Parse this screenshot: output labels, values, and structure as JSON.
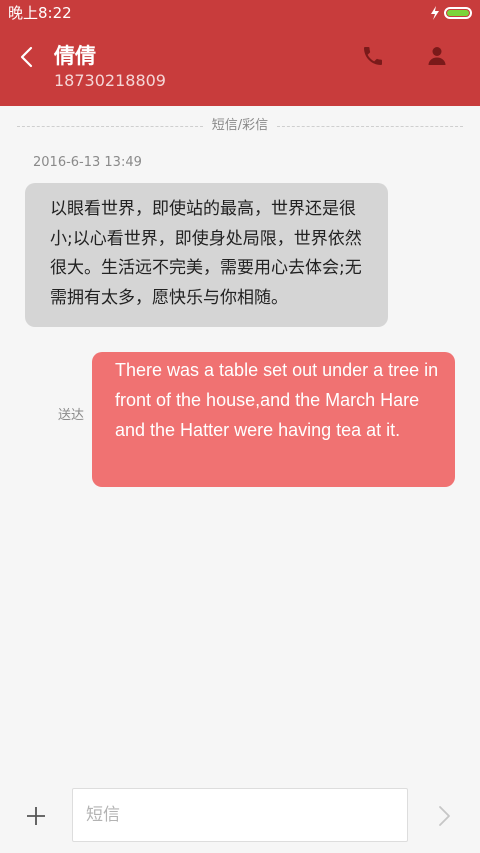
{
  "status_bar": {
    "time": "晚上8:22",
    "battery_level": 1.0,
    "battery_color": "#7bd43a"
  },
  "header": {
    "contact_name": "倩倩",
    "contact_number": "18730218809",
    "background_color": "#c83c3c",
    "back_icon": "chevron-left-icon",
    "call_icon": "phone-icon",
    "contact_icon": "person-icon"
  },
  "conversation": {
    "divider_label": "短信/彩信",
    "timestamp": "2016-6-13 13:49",
    "messages": [
      {
        "direction": "incoming",
        "text": "以眼看世界，即使站的最高，世界还是很小;以心看世界，即使身处局限，世界依然很大。生活远不完美，需要用心去体会;无需拥有太多，愿快乐与你相随。",
        "bubble_color": "#d5d5d5"
      },
      {
        "direction": "outgoing",
        "status": "送达",
        "text": "There was a table set out under a tree in front of the house,and the March Hare and the Hatter were having tea at it.",
        "bubble_color": "#f07272"
      }
    ]
  },
  "composer": {
    "placeholder": "短信",
    "value": "",
    "add_icon": "plus-icon",
    "send_icon": "chevron-right-icon"
  }
}
